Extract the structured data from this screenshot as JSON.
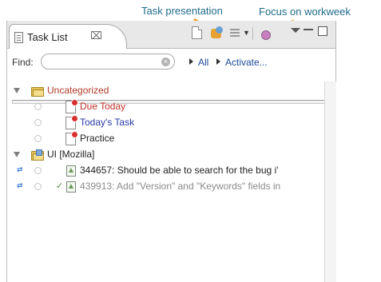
{
  "annotations": {
    "task_presentation": "Task presentation",
    "focus_workweek": "Focus on workweek"
  },
  "view": {
    "tab_title": "Task List",
    "tab_close": "⌧",
    "toolbar": {
      "view_menu_icon": "chevron-down-icon",
      "list_dropdown_icon": "▼"
    }
  },
  "find": {
    "label": "Find:",
    "value": "",
    "placeholder": "",
    "clear_glyph": "×",
    "all_label": "All",
    "activate_label": "Activate..."
  },
  "tree": {
    "categories": [
      {
        "name": "Uncategorized",
        "color": "#b33a2a",
        "tasks": [
          {
            "label": "Due Today",
            "color": "#c0302a"
          },
          {
            "label": "Today's Task",
            "color": "#2a3aa8"
          },
          {
            "label": "Practice",
            "color": "#222222"
          }
        ]
      },
      {
        "name": "UI  [Mozilla]",
        "color": "#222222",
        "tasks": [
          {
            "label": "344657: Should be able to search for the bug i'",
            "color": "#222222",
            "incoming": "⇄"
          },
          {
            "label": "439913: Add \"Version\" and \"Keywords\" fields in",
            "color": "#8a8a8a",
            "incoming": "⇄",
            "completed": "✓"
          }
        ]
      }
    ]
  },
  "colors": {
    "annotation_text": "#1e6b8a",
    "annotation_arrow": "#f0a020",
    "link": "#1f4a9c"
  }
}
